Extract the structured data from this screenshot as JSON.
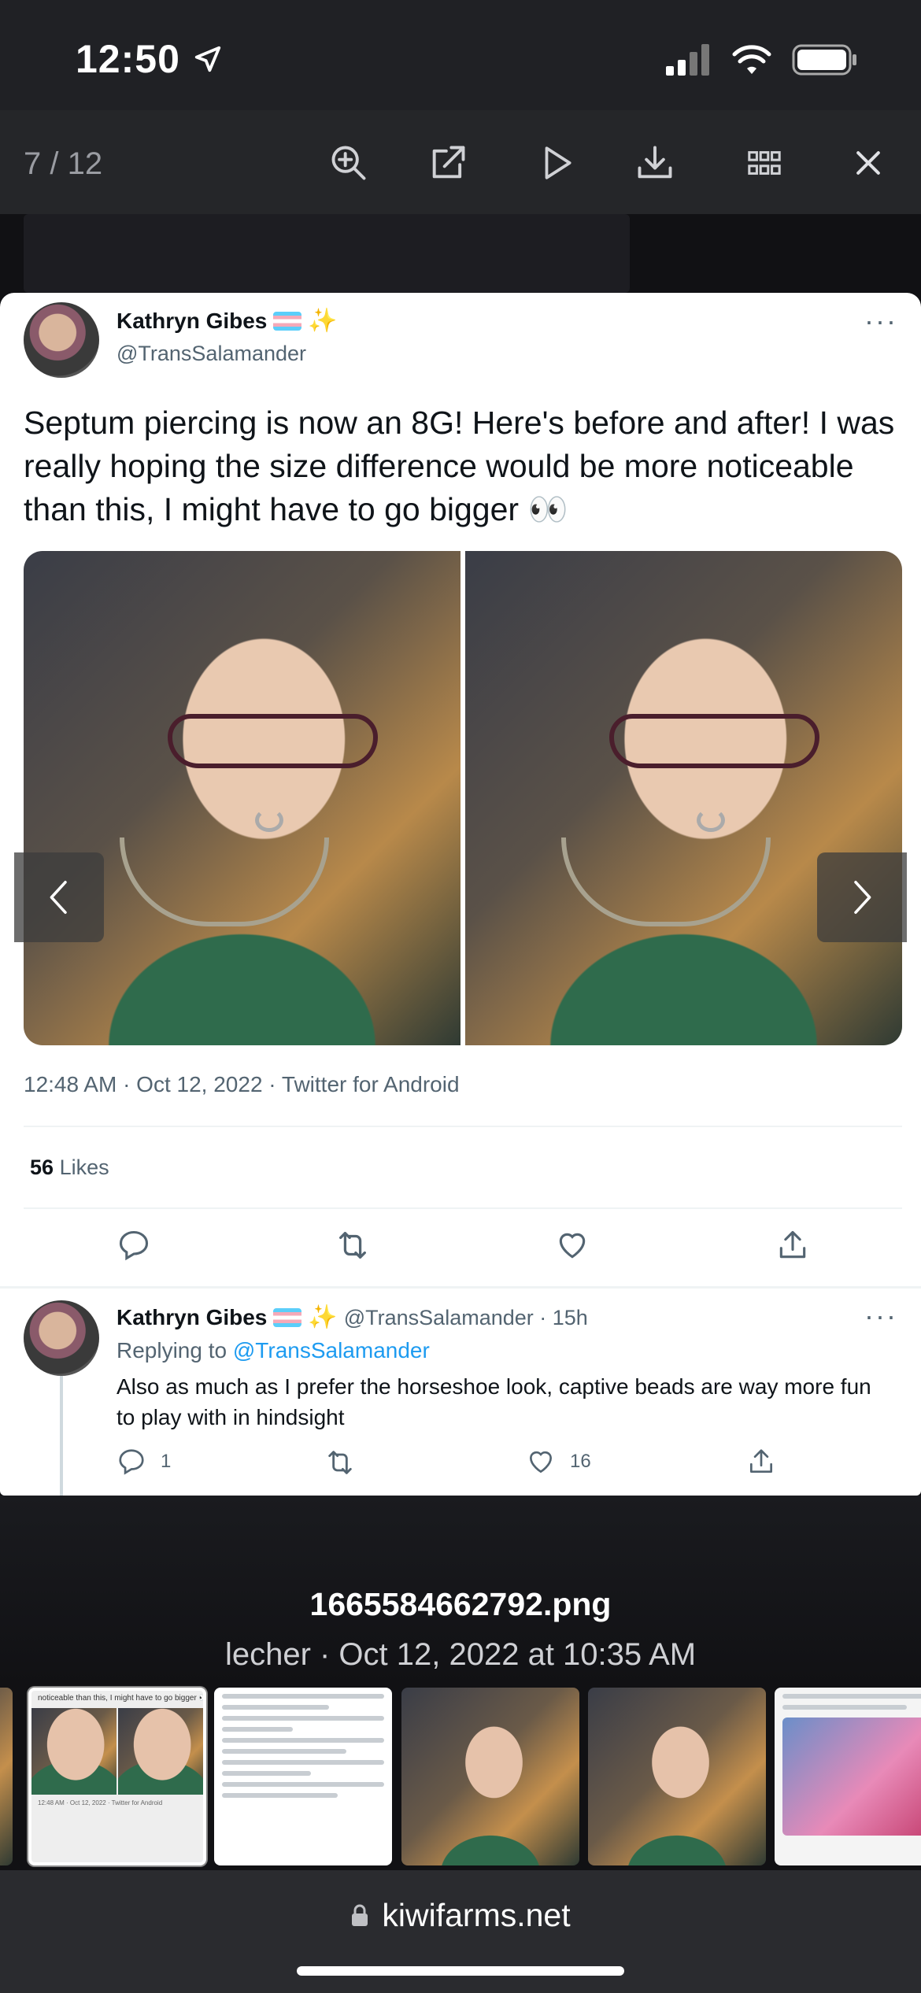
{
  "status_bar": {
    "time": "12:50"
  },
  "viewer": {
    "counter": "7 / 12",
    "toolbar": [
      "zoom-in",
      "open-external",
      "play",
      "download",
      "grid",
      "close"
    ]
  },
  "tweet": {
    "author_name": "Kathryn Gibes",
    "author_handle": "@TransSalamander",
    "text": "Septum piercing is now an 8G! Here's before and after! I was really hoping the size difference would be more noticeable than this, I might have to go bigger 👀",
    "timestamp": "12:48 AM · Oct 12, 2022 · Twitter for Android",
    "likes_count": "56",
    "likes_label": "Likes"
  },
  "reply": {
    "author_name": "Kathryn Gibes",
    "meta": "@TransSalamander · 15h",
    "replying_prefix": "Replying to",
    "replying_to": "@TransSalamander",
    "text": "Also as much as I prefer the horseshoe look, captive beads are way more fun to play with in hindsight",
    "reply_count": "1",
    "like_count": "16"
  },
  "caption": {
    "filename": "1665584662792.png",
    "byline": "lecher · Oct 12, 2022 at 10:35 AM"
  },
  "thumb_text": {
    "t1_caption": "noticeable than this, I might have to go bigger 👀",
    "t1_meta": "12:48 AM · Oct 12, 2022 · Twitter for Android"
  },
  "url_bar": {
    "domain": "kiwifarms.net"
  },
  "colors": {
    "accent_link": "#1d9bf0",
    "card_bg": "#ffffff",
    "chrome_bg": "#252629"
  }
}
